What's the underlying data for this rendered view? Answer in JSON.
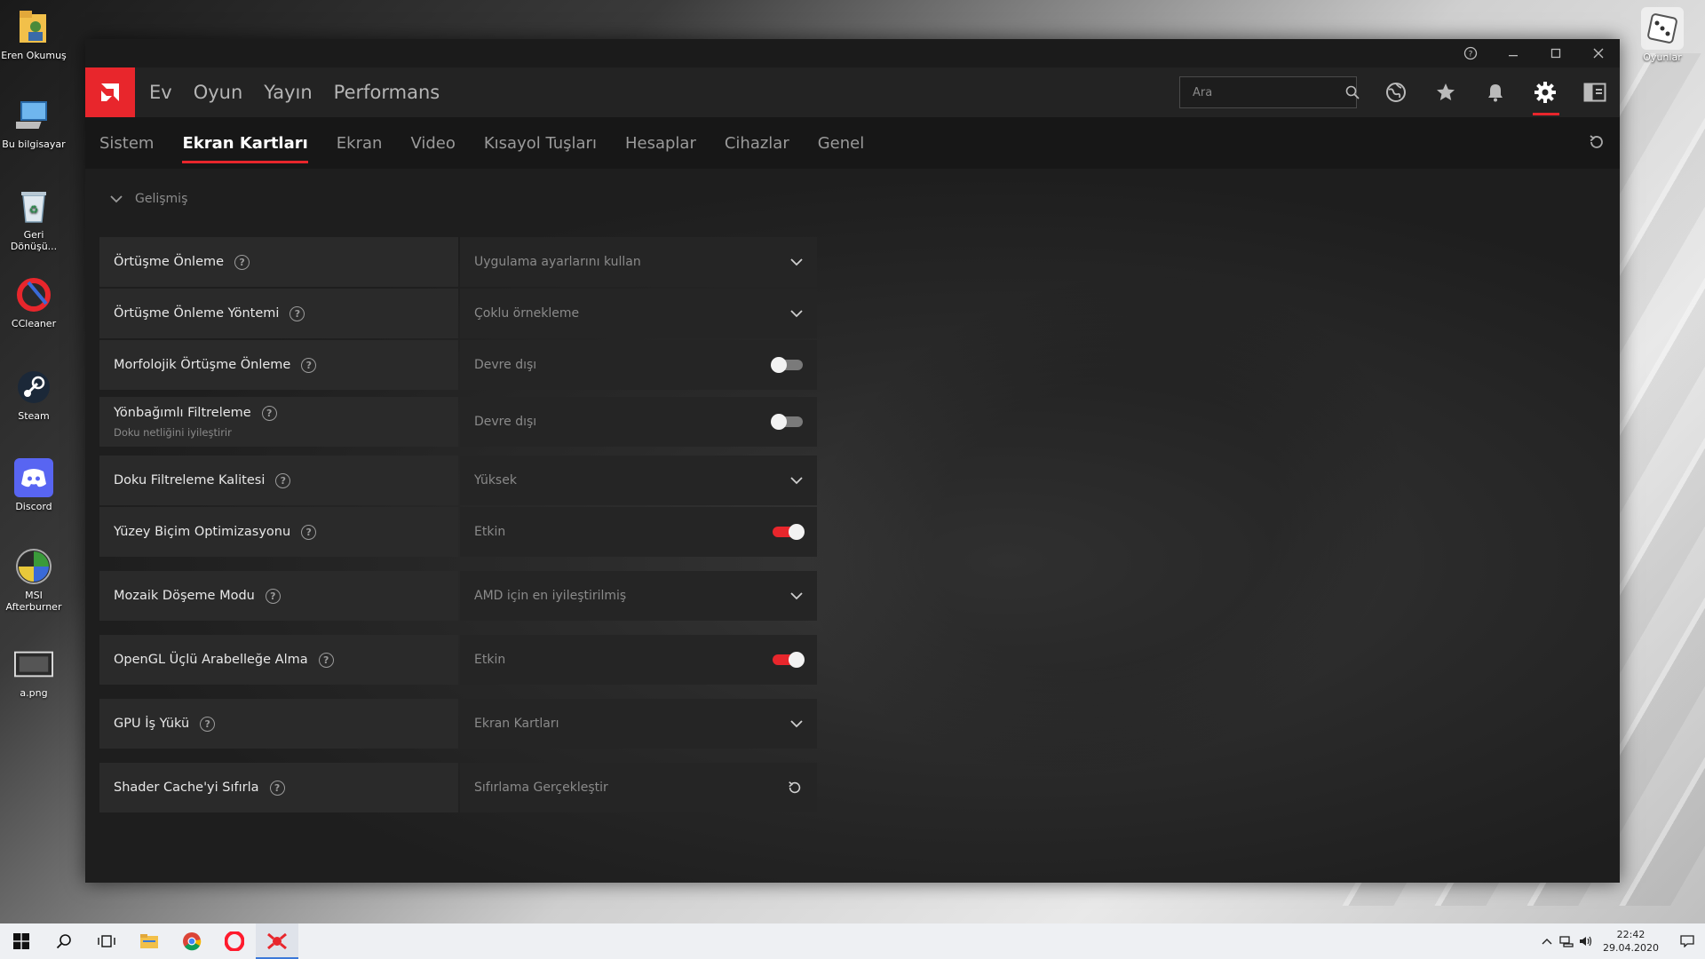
{
  "desktop": {
    "left_icons": [
      {
        "label": "Eren Okumuş",
        "icon": "user-folder-icon"
      },
      {
        "label": "Bu bilgisayar",
        "icon": "computer-icon"
      },
      {
        "label": "Geri Dönüşü...",
        "icon": "recycle-bin-icon"
      },
      {
        "label": "CCleaner",
        "icon": "ccleaner-icon"
      },
      {
        "label": "Steam",
        "icon": "steam-icon"
      },
      {
        "label": "Discord",
        "icon": "discord-icon"
      },
      {
        "label": "MSI Afterburner",
        "icon": "msi-afterburner-icon"
      },
      {
        "label": "a.png",
        "icon": "image-file-icon"
      }
    ],
    "right_icon": {
      "label": "Oyunlar",
      "icon": "games-dice-icon"
    }
  },
  "app": {
    "main_nav": [
      "Ev",
      "Oyun",
      "Yayın",
      "Performans"
    ],
    "search": {
      "placeholder": "Ara"
    },
    "sub_nav": [
      "Sistem",
      "Ekran Kartları",
      "Ekran",
      "Video",
      "Kısayol Tuşları",
      "Hesaplar",
      "Cihazlar",
      "Genel"
    ],
    "active_sub_nav": "Ekran Kartları",
    "section_title": "Gelişmiş",
    "colors": {
      "accent": "#e8262c"
    },
    "settings": [
      {
        "label": "Örtüşme Önleme",
        "value": "Uygulama ayarlarını kullan",
        "control": "dropdown"
      },
      {
        "label": "Örtüşme Önleme Yöntemi",
        "value": "Çoklu örnekleme",
        "control": "dropdown"
      },
      {
        "label": "Morfolojik Örtüşme Önleme",
        "value": "Devre dışı",
        "control": "toggle-off"
      },
      {
        "label": "Yönbağımlı Filtreleme",
        "sublabel": "Doku netliğini iyileştirir",
        "value": "Devre dışı",
        "control": "toggle-off"
      },
      {
        "label": "Doku Filtreleme Kalitesi",
        "value": "Yüksek",
        "control": "dropdown"
      },
      {
        "label": "Yüzey Biçim Optimizasyonu",
        "value": "Etkin",
        "control": "toggle-on"
      },
      {
        "label": "Mozaik Döşeme Modu",
        "value": "AMD için en iyileştirilmiş",
        "control": "dropdown"
      },
      {
        "label": "OpenGL Üçlü Arabelleğe Alma",
        "value": "Etkin",
        "control": "toggle-on"
      },
      {
        "label": "GPU İş Yükü",
        "value": "Ekran Kartları",
        "control": "dropdown"
      },
      {
        "label": "Shader Cache'yi Sıfırla",
        "value": "Sıfırlama Gerçekleştir",
        "control": "reset"
      }
    ]
  },
  "taskbar": {
    "clock_time": "22:42",
    "clock_date": "29.04.2020"
  }
}
